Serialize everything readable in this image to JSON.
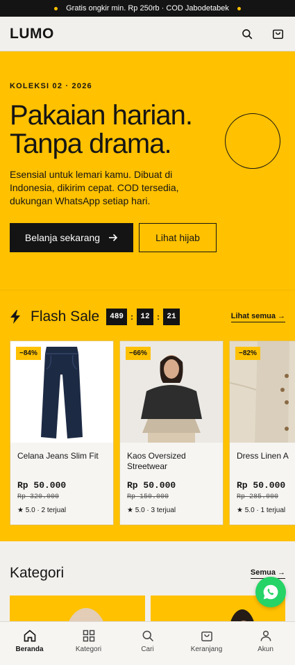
{
  "announcement": {
    "text": "Gratis ongkir min. Rp 250rb · COD Jabodetabek"
  },
  "header": {
    "logo": "LUMO",
    "icons": [
      "search-icon",
      "bag-icon"
    ]
  },
  "hero": {
    "eyebrow": "KOLEKSI 02 · 2026",
    "title_line1": "Pakaian harian.",
    "title_line2": "Tanpa drama.",
    "description": "Esensial untuk lemari kamu. Dibuat di Indonesia, dikirim cepat. COD tersedia, dukungan WhatsApp setiap hari.",
    "primary_cta": "Belanja sekarang",
    "secondary_cta": "Lihat hijab"
  },
  "flash_sale": {
    "title": "Flash Sale",
    "countdown": {
      "hours": "489",
      "minutes": "12",
      "seconds": "21"
    },
    "see_all": "Lihat semua",
    "products": [
      {
        "name": "Celana Jeans Slim Fit",
        "discount": "−84%",
        "price": "Rp 50.000",
        "old_price": "Rp 320.000",
        "rating": "5.0 · 2 terjual"
      },
      {
        "name": "Kaos Oversized Streetwear",
        "discount": "−66%",
        "price": "Rp 50.000",
        "old_price": "Rp 150.000",
        "rating": "5.0 · 3 terjual"
      },
      {
        "name": "Dress Linen A",
        "discount": "−82%",
        "price": "Rp 50.000",
        "old_price": "Rp 285.000",
        "rating": "5.0 · 1 terjual"
      }
    ]
  },
  "kategori": {
    "title": "Kategori",
    "see_all": "Semua"
  },
  "tabbar": {
    "items": [
      {
        "label": "Beranda",
        "icon": "home-icon",
        "active": true
      },
      {
        "label": "Kategori",
        "icon": "grid-icon",
        "active": false
      },
      {
        "label": "Cari",
        "icon": "search-icon",
        "active": false
      },
      {
        "label": "Keranjang",
        "icon": "bag-icon",
        "active": false
      },
      {
        "label": "Akun",
        "icon": "user-icon",
        "active": false
      }
    ]
  },
  "colors": {
    "accent": "#ffc100",
    "dark": "#141414",
    "background": "#f2f0ec",
    "whatsapp": "#25d366"
  }
}
